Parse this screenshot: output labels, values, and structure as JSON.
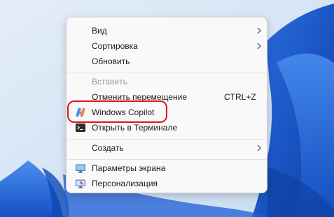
{
  "context_menu": {
    "items": [
      {
        "label": "Вид",
        "has_submenu": true
      },
      {
        "label": "Сортировка",
        "has_submenu": true
      },
      {
        "label": "Обновить"
      },
      {
        "label": "Вставить",
        "disabled": true
      },
      {
        "label": "Отменить перемещение",
        "shortcut": "CTRL+Z"
      },
      {
        "label": "Windows Copilot",
        "icon": "copilot-icon"
      },
      {
        "label": "Открыть в Терминале",
        "icon": "terminal-icon"
      },
      {
        "label": "Создать",
        "has_submenu": true
      },
      {
        "label": "Параметры экрана",
        "icon": "display-settings-icon"
      },
      {
        "label": "Персонализация",
        "icon": "personalization-icon"
      }
    ]
  },
  "colors": {
    "highlight_outline": "#e0141b",
    "menu_background": "#f9f9f9",
    "disabled_text": "#9a9a9a"
  }
}
